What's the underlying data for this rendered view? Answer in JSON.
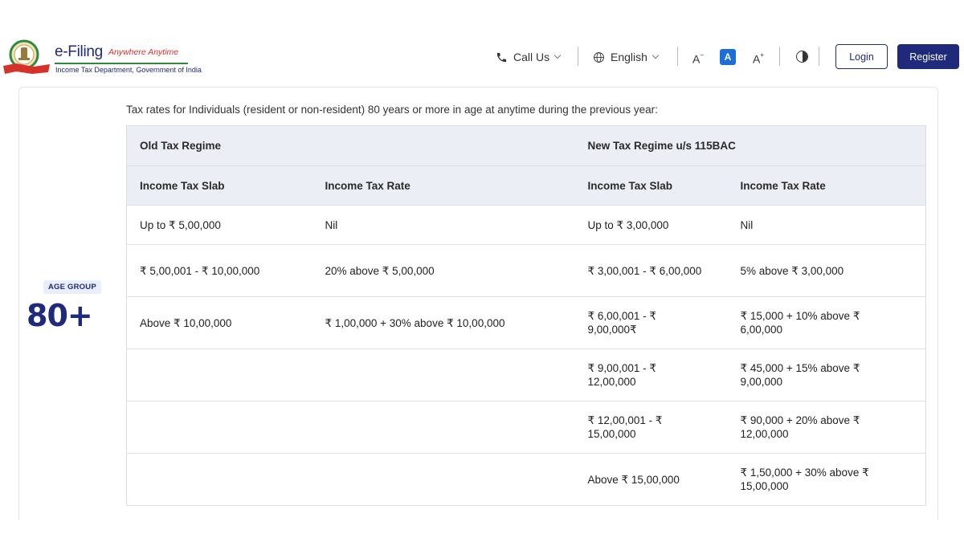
{
  "header": {
    "brand_title": "e-Filing",
    "brand_tagline": "Anywhere Anytime",
    "brand_subtitle": "Income Tax Department, Government of India",
    "call_label": "Call Us",
    "language_label": "English",
    "font_decrease": "A",
    "font_default": "A",
    "font_increase": "A",
    "login_label": "Login",
    "register_label": "Register"
  },
  "age_group": {
    "badge": "AGE GROUP",
    "value": "80+"
  },
  "description": "Tax rates for Individuals (resident or non-resident) 80 years or more in age at anytime during the previous year:",
  "table": {
    "old_regime_title": "Old Tax Regime",
    "new_regime_title": "New Tax Regime u/s 115BAC",
    "columns": [
      "Income Tax Slab",
      "Income Tax Rate",
      "Income Tax Slab",
      "Income Tax Rate"
    ],
    "rows": [
      [
        "Up to ₹ 5,00,000",
        "Nil",
        "Up to ₹ 3,00,000",
        "Nil"
      ],
      [
        "₹ 5,00,001 - ₹ 10,00,000",
        "20% above ₹ 5,00,000",
        "₹ 3,00,001 - ₹ 6,00,000",
        "5% above ₹ 3,00,000"
      ],
      [
        "Above ₹ 10,00,000",
        "₹ 1,00,000 + 30% above ₹ 10,00,000",
        "₹ 6,00,001 - ₹ 9,00,000₹",
        "₹ 15,000 + 10% above ₹ 6,00,000"
      ],
      [
        "",
        "",
        "₹ 9,00,001 - ₹ 12,00,000",
        "₹ 45,000 + 15% above ₹ 9,00,000"
      ],
      [
        "",
        "",
        "₹ 12,00,001 - ₹ 15,00,000",
        "₹ 90,000 + 20% above ₹ 12,00,000"
      ],
      [
        "",
        "",
        "Above ₹ 15,00,000",
        "₹ 1,50,000 + 30% above ₹ 15,00,000"
      ]
    ]
  },
  "colors": {
    "brand_navy": "#1f2a7a",
    "accent_blue": "#1c6ed8",
    "header_row_bg": "#eceef6",
    "tagline_red": "#d6322b"
  }
}
